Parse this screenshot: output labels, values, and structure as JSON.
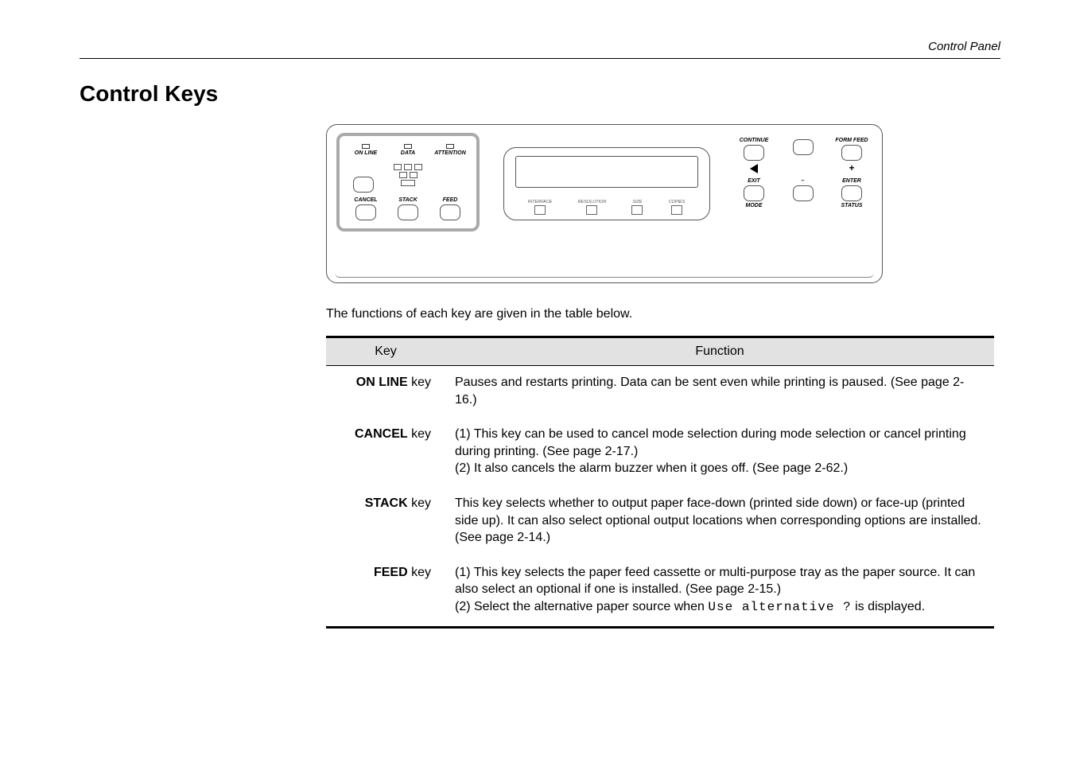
{
  "header": {
    "section": "Control Panel"
  },
  "title": "Control Keys",
  "panel": {
    "leds": [
      "ON LINE",
      "DATA",
      "ATTENTION"
    ],
    "left_buttons": [
      "CANCEL",
      "STACK",
      "FEED"
    ],
    "lcd_icons": [
      "INTERFACE",
      "RESOLUTION",
      "SIZE",
      "COPIES"
    ],
    "right_top": [
      "CONTINUE",
      "",
      "FORM FEED"
    ],
    "right_mid_symbols": [
      "◄",
      "",
      "+"
    ],
    "right_bot_top": [
      "EXIT",
      "–",
      "ENTER"
    ],
    "right_bot_bot": [
      "MODE",
      "",
      "STATUS"
    ]
  },
  "intro": "The functions of each key are given in the table below.",
  "table": {
    "headers": [
      "Key",
      "Function"
    ],
    "rows": [
      {
        "key_bold": "ON LINE",
        "key_suffix": " key",
        "function": "Pauses and restarts printing.  Data can be sent even while printing is paused. (See page 2-16.)"
      },
      {
        "key_bold": "CANCEL",
        "key_suffix": " key",
        "function": "(1) This key can be used to cancel mode selection during mode selection or cancel printing during printing. (See page 2-17.)\n(2) It also cancels the alarm buzzer when it goes off. (See page 2-62.)"
      },
      {
        "key_bold": "STACK",
        "key_suffix": " key",
        "function": "This key selects whether to output paper face-down (printed side down) or face-up (printed side up).  It can also select optional output locations when corresponding options are installed. (See page 2-14.)"
      },
      {
        "key_bold": "FEED",
        "key_suffix": " key",
        "function_pre": "(1) This key selects the paper feed cassette or multi-purpose tray as the paper source. It can also select an optional if one is installed. (See page 2-15.)\n(2) Select the alternative paper source when ",
        "function_mono": "Use alternative ?",
        "function_post": " is displayed."
      }
    ]
  }
}
